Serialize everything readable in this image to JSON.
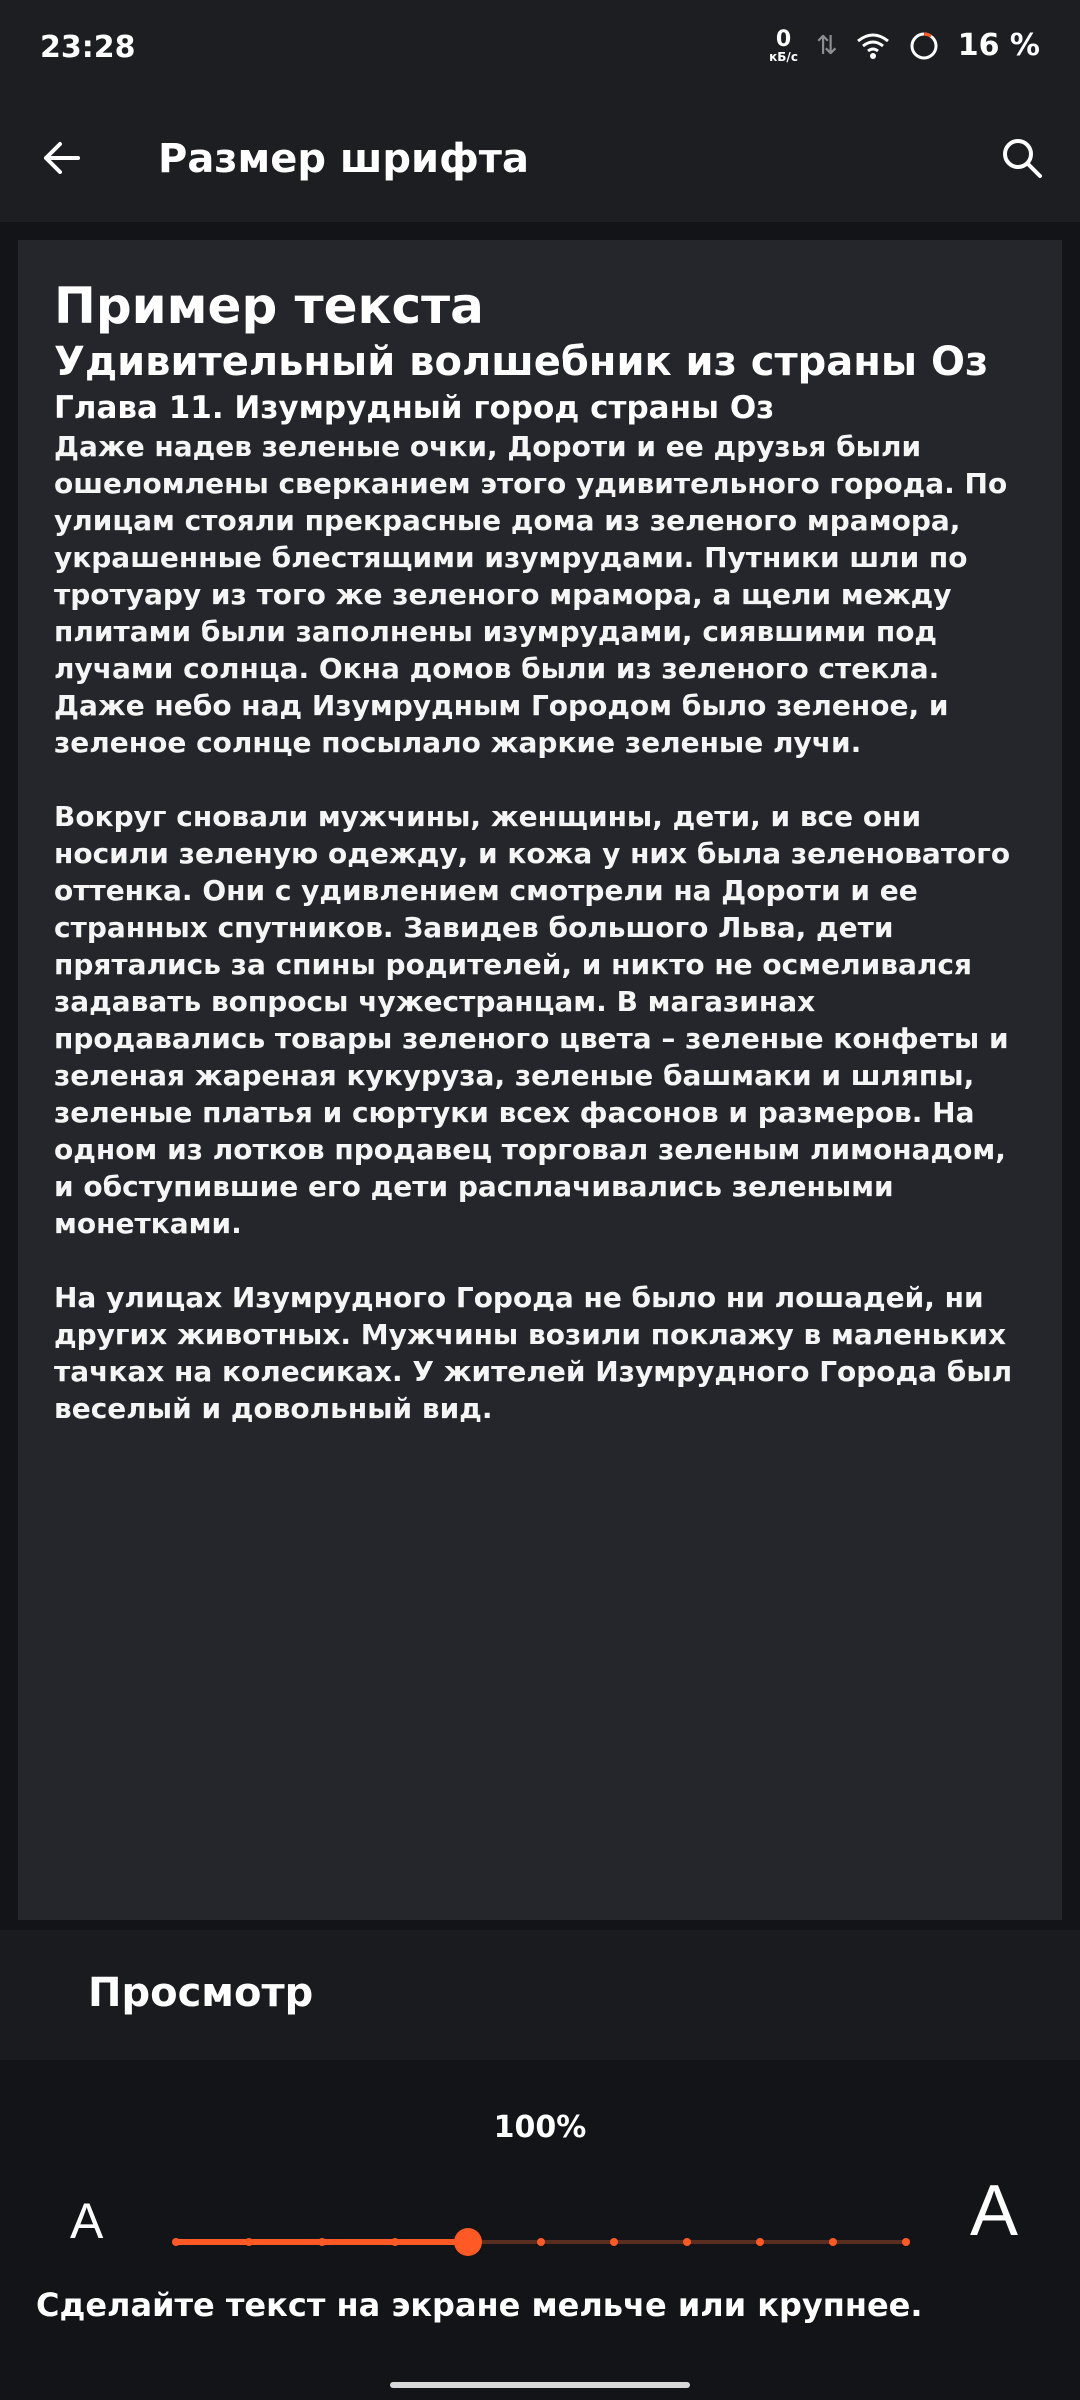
{
  "status_bar": {
    "time": "23:28",
    "net_speed_value": "0",
    "net_speed_unit": "кБ/с",
    "battery": "16 %"
  },
  "app_bar": {
    "title": "Размер шрифта",
    "back_icon": "arrow-left-icon",
    "search_icon": "search-icon"
  },
  "preview": {
    "sample_title": "Пример текста",
    "book_title": "Удивительный волшебник из страны Оз",
    "chapter_title": "Глава 11. Изумрудный город страны Оз",
    "paragraphs": [
      "Даже надев зеленые очки, Дороти и ее друзья были ошеломлены сверканием этого удивительного города. По улицам стояли прекрасные дома из зеленого мрамора, украшенные блестящими изумрудами. Путники шли по тротуару из того же зеленого мрамора, а щели между плитами были заполнены изумрудами, сиявшими под лучами солнца. Окна домов были из зеленого стекла. Даже небо над Изумрудным Городом было зеленое, и зеленое солнце посылало жаркие зеленые лучи.",
      "Вокруг сновали мужчины, женщины, дети, и все они носили зеленую одежду, и кожа у них была зеленоватого оттенка. Они с удивлением смотрели на Дороти и ее странных спутников. Завидев большого Льва, дети прятались за спины родителей, и никто не осмеливался задавать вопросы чужестранцам. В магазинах продавались товары зеленого цвета – зеленые конфеты и зеленая жареная кукуруза, зеленые башмаки и шляпы, зеленые платья и сюртуки всех фасонов и размеров. На одном из лотков продавец торговал зеленым лимонадом, и обступившие его дети расплачивались зелеными монетками.",
      "На улицах Изумрудного Города не было ни лошадей, ни других животных. Мужчины возили поклажу в маленьких тачках на колесиках. У жителей Изумрудного Города был веселый и довольный вид."
    ]
  },
  "preview_label": "Просмотр",
  "font_control": {
    "percent": "100%",
    "small_label": "A",
    "large_label": "A",
    "steps": 11,
    "current_step_index": 4,
    "accent_color": "#ff5a26",
    "hint": "Сделайте текст на экране мельче или крупнее."
  }
}
